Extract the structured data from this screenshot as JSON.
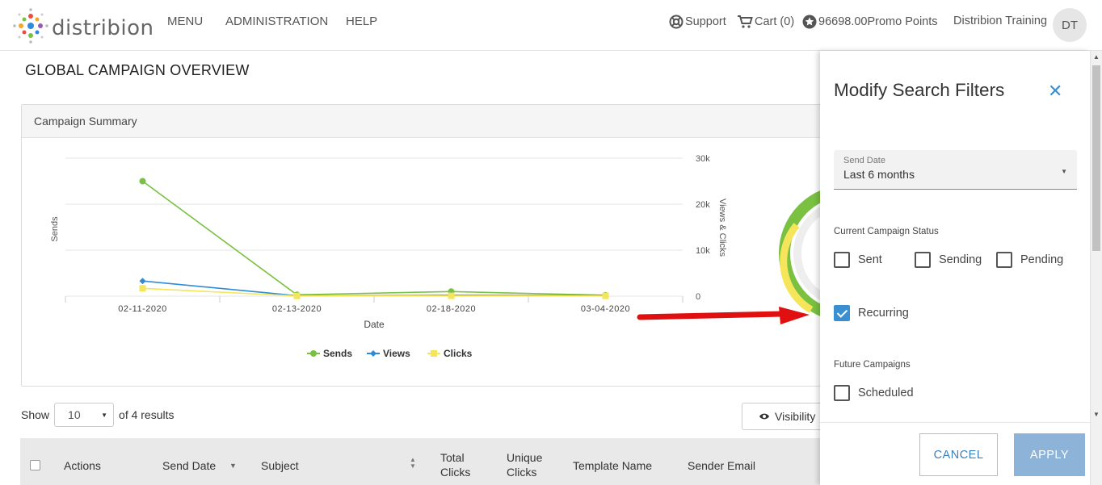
{
  "header": {
    "logo_text": "distribion",
    "nav": [
      "MENU",
      "ADMINISTRATION",
      "HELP"
    ],
    "support_label": "Support",
    "cart_label": "Cart (0)",
    "points_label": "96698.00Promo Points",
    "user_name": "Distribion Training",
    "avatar_initials": "DT"
  },
  "page": {
    "title": "GLOBAL CAMPAIGN OVERVIEW"
  },
  "summary": {
    "title": "Campaign Summary"
  },
  "chart_data": {
    "type": "line",
    "categories": [
      "02-11-2020",
      "02-13-2020",
      "02-18-2020",
      "03-04-2020"
    ],
    "xlabel": "Date",
    "ylabel": "Sends",
    "y2label": "Views & Clicks",
    "y2lim": [
      0,
      30000
    ],
    "y2ticks": [
      "30k",
      "20k",
      "10k",
      "0"
    ],
    "series": [
      {
        "name": "Sends",
        "axis": "left",
        "color": "#7ac142",
        "values": [
          25000,
          300,
          1000,
          200
        ]
      },
      {
        "name": "Views",
        "axis": "right",
        "color": "#2e8bd8",
        "values": [
          3300,
          100,
          200,
          150
        ]
      },
      {
        "name": "Clicks",
        "axis": "right",
        "color": "#f5e55a",
        "values": [
          1700,
          50,
          80,
          60
        ]
      }
    ],
    "ylim": [
      0,
      30000
    ],
    "legend": "bottom-center",
    "grid": true
  },
  "table": {
    "show_label": "Show",
    "page_size": "10",
    "results_text": "of 4 results",
    "visibility_label": "Visibility",
    "columns": [
      "Actions",
      "Send Date",
      "Subject",
      "Total Clicks",
      "Unique Clicks",
      "Template Name",
      "Sender Email"
    ]
  },
  "filters": {
    "title": "Modify Search Filters",
    "send_date_label": "Send Date",
    "send_date_value": "Last 6 months",
    "status_section": "Current Campaign Status",
    "status_options": [
      {
        "label": "Sent",
        "checked": false
      },
      {
        "label": "Sending",
        "checked": false
      },
      {
        "label": "Pending",
        "checked": false
      },
      {
        "label": "Recurring",
        "checked": true
      }
    ],
    "future_section": "Future Campaigns",
    "future_options": [
      {
        "label": "Scheduled",
        "checked": false
      }
    ],
    "cancel_label": "CANCEL",
    "apply_label": "APPLY"
  },
  "colors": {
    "accent": "#3a8fd0",
    "apply_bg": "#8db3d8",
    "arrow": "#e01010"
  }
}
